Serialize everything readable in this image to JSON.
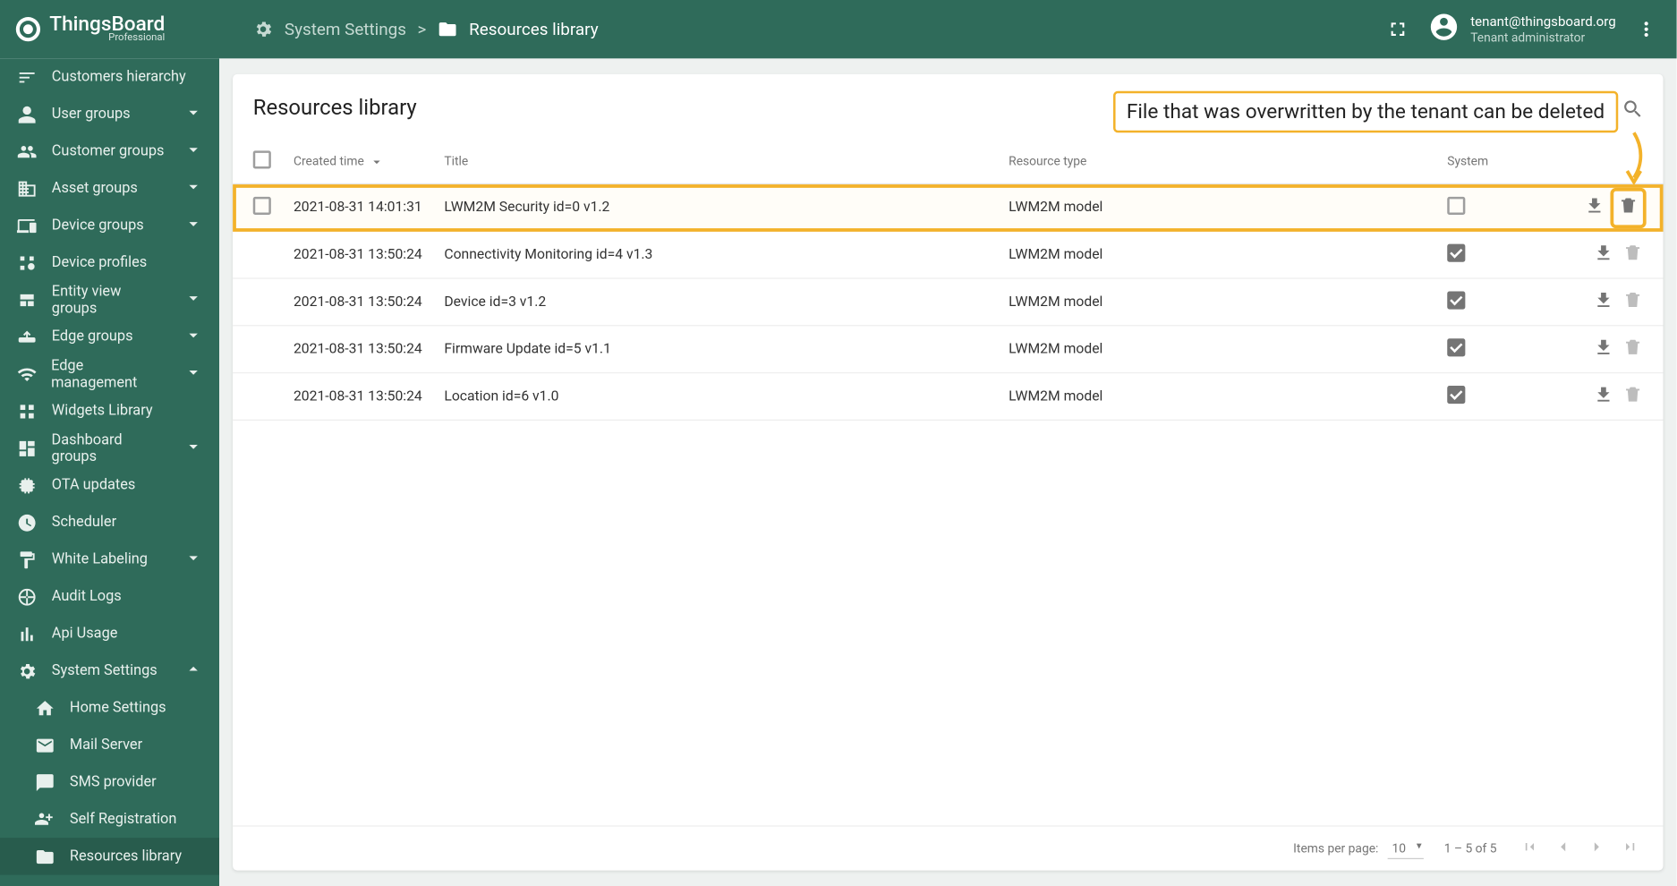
{
  "brand": {
    "name": "ThingsBoard",
    "edition": "Professional"
  },
  "breadcrumb": {
    "parent": "System Settings",
    "sep": ">",
    "current": "Resources library"
  },
  "user": {
    "email": "tenant@thingsboard.org",
    "role": "Tenant administrator"
  },
  "sidebar": {
    "items": [
      {
        "icon": "sort",
        "label": "Customers hierarchy",
        "expand": false
      },
      {
        "icon": "supervisor",
        "label": "User groups",
        "expand": true
      },
      {
        "icon": "people",
        "label": "Customer groups",
        "expand": true
      },
      {
        "icon": "domain",
        "label": "Asset groups",
        "expand": true
      },
      {
        "icon": "devices-other",
        "label": "Device groups",
        "expand": true
      },
      {
        "icon": "device-profile",
        "label": "Device profiles",
        "expand": false
      },
      {
        "icon": "view-quilt",
        "label": "Entity view groups",
        "expand": true
      },
      {
        "icon": "router",
        "label": "Edge groups",
        "expand": true
      },
      {
        "icon": "wifi",
        "label": "Edge management",
        "expand": true
      },
      {
        "icon": "widgets",
        "label": "Widgets Library",
        "expand": false
      },
      {
        "icon": "dashboard",
        "label": "Dashboard groups",
        "expand": true
      },
      {
        "icon": "memory",
        "label": "OTA updates",
        "expand": false
      },
      {
        "icon": "schedule",
        "label": "Scheduler",
        "expand": false
      },
      {
        "icon": "format-paint",
        "label": "White Labeling",
        "expand": true
      },
      {
        "icon": "track-changes",
        "label": "Audit Logs",
        "expand": false
      },
      {
        "icon": "bar-chart",
        "label": "Api Usage",
        "expand": false
      },
      {
        "icon": "settings",
        "label": "System Settings",
        "expand": true,
        "expanded": true
      }
    ],
    "subitems": [
      {
        "icon": "home",
        "label": "Home Settings"
      },
      {
        "icon": "mail",
        "label": "Mail Server"
      },
      {
        "icon": "sms",
        "label": "SMS provider"
      },
      {
        "icon": "group-add",
        "label": "Self Registration"
      },
      {
        "icon": "folder",
        "label": "Resources library",
        "selected": true
      }
    ]
  },
  "page": {
    "title": "Resources library",
    "callout": "File that was overwritten by the tenant can be deleted",
    "columns": {
      "created": "Created time",
      "title": "Title",
      "type": "Resource type",
      "system": "System"
    },
    "rows": [
      {
        "created": "2021-08-31 14:01:31",
        "title": "LWM2M Security id=0 v1.2",
        "type": "LWM2M model",
        "system": false,
        "deletable": true,
        "hl": true
      },
      {
        "created": "2021-08-31 13:50:24",
        "title": "Connectivity Monitoring id=4 v1.3",
        "type": "LWM2M model",
        "system": true,
        "deletable": false
      },
      {
        "created": "2021-08-31 13:50:24",
        "title": "Device id=3 v1.2",
        "type": "LWM2M model",
        "system": true,
        "deletable": false
      },
      {
        "created": "2021-08-31 13:50:24",
        "title": "Firmware Update id=5 v1.1",
        "type": "LWM2M model",
        "system": true,
        "deletable": false
      },
      {
        "created": "2021-08-31 13:50:24",
        "title": "Location id=6 v1.0",
        "type": "LWM2M model",
        "system": true,
        "deletable": false
      }
    ],
    "paginator": {
      "label": "Items per page:",
      "size": "10",
      "range": "1 – 5 of 5"
    }
  }
}
